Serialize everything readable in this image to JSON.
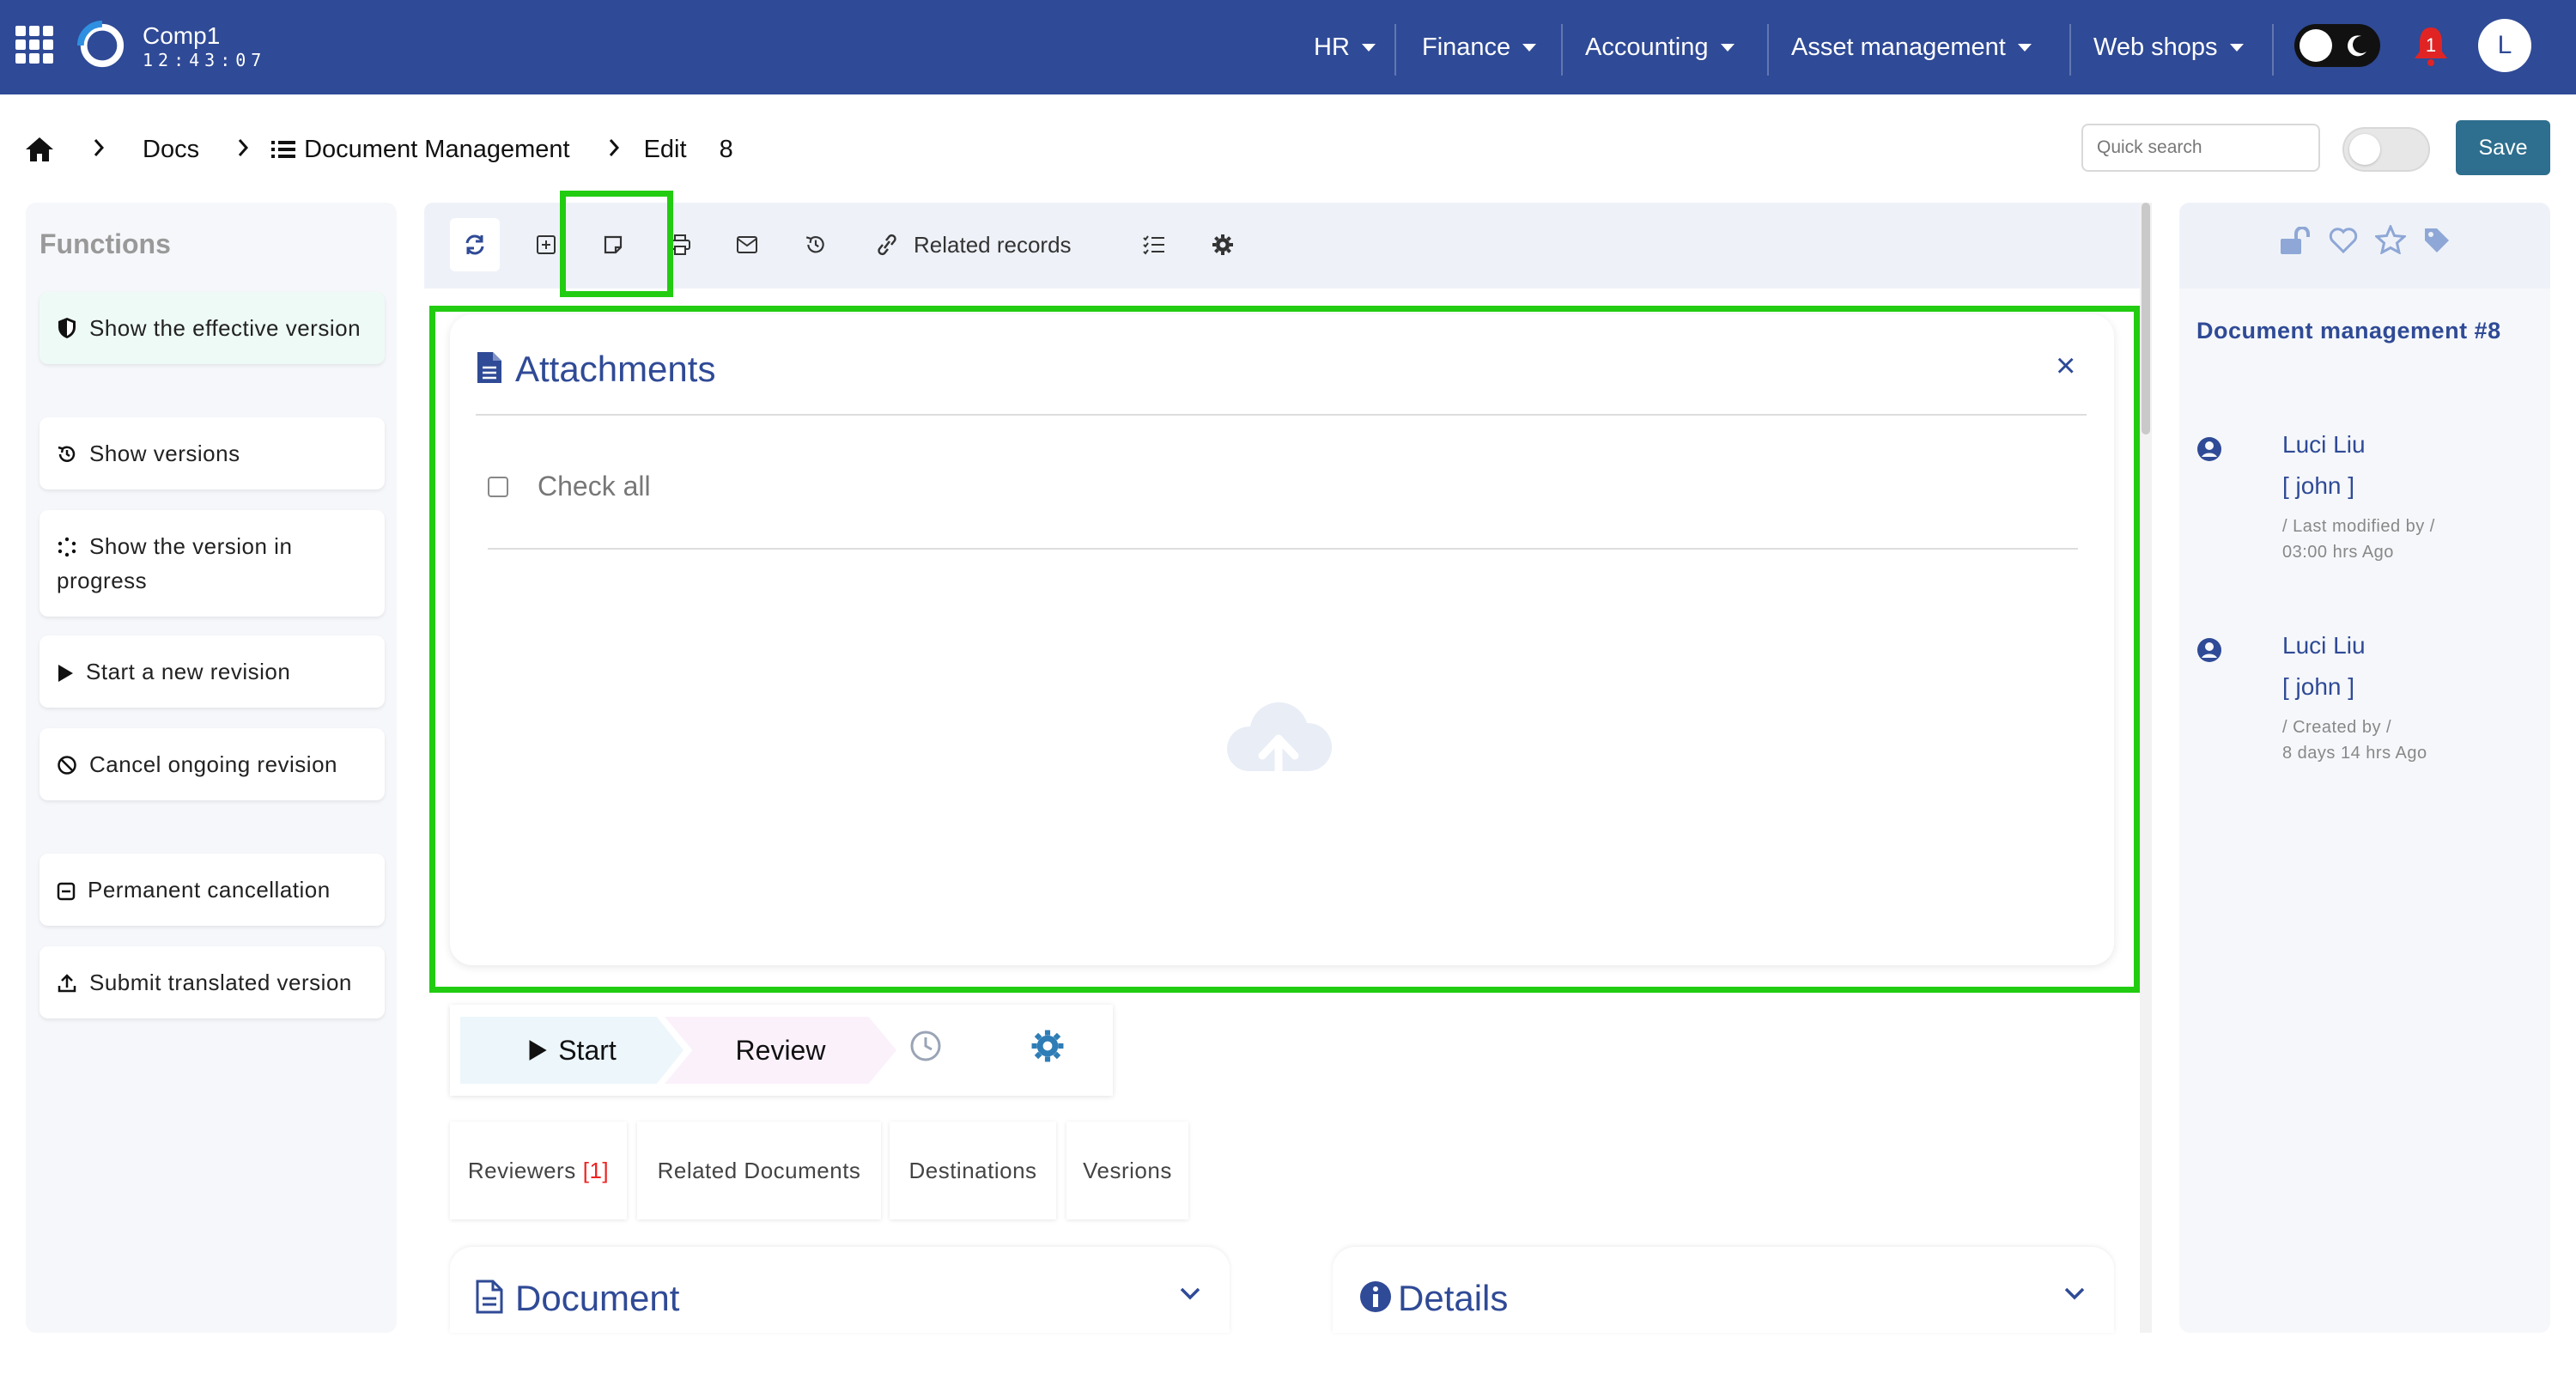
{
  "header": {
    "company": "Comp1",
    "clock": "12:43:07",
    "menus": [
      "HR",
      "Finance",
      "Accounting",
      "Asset management",
      "Web shops"
    ],
    "notifications": "1",
    "avatar_initial": "L"
  },
  "breadcrumb": {
    "docs": "Docs",
    "module": "Document Management",
    "action": "Edit",
    "record_id": "8"
  },
  "search": {
    "placeholder": "Quick search"
  },
  "save_label": "Save",
  "functions": {
    "title": "Functions",
    "items": [
      "Show the effective version",
      "Show versions",
      "Show the version in progress",
      "Start a new revision",
      "Cancel ongoing revision",
      "Permanent cancellation",
      "Submit translated version"
    ]
  },
  "toolbar": {
    "related_records": "Related records"
  },
  "attachments": {
    "title": "Attachments",
    "close": "×",
    "check_all": "Check all"
  },
  "workflow": {
    "start": "Start",
    "review": "Review"
  },
  "tabs": {
    "reviewers": "Reviewers",
    "reviewers_count": "[1]",
    "related_documents": "Related Documents",
    "destinations": "Destinations",
    "versions": "Vesrions"
  },
  "cards": {
    "document": "Document",
    "details": "Details"
  },
  "right_panel": {
    "title": "Document management #8",
    "entries": [
      {
        "name": "Luci Liu",
        "username": "[ john ]",
        "action": "/ Last modified by /",
        "time": "03:00 hrs Ago"
      },
      {
        "name": "Luci Liu",
        "username": "[ john ]",
        "action": "/ Created by /",
        "time": "8 days 14 hrs Ago"
      }
    ]
  },
  "colors": {
    "brand": "#2f4a96",
    "highlight": "#22cc11",
    "save": "#2e6e8e"
  }
}
